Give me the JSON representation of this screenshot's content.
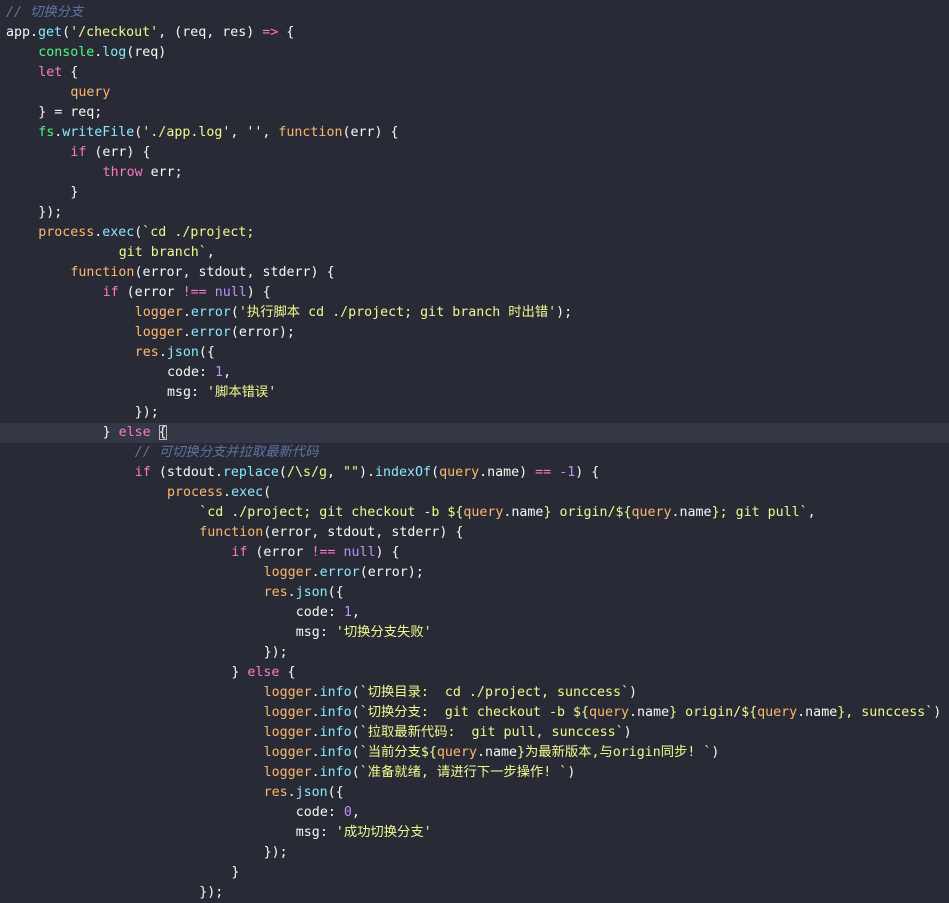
{
  "editor": {
    "background": "#282a36",
    "active_line_background": "#343746",
    "active_line": 21,
    "colors": {
      "comment": "#6272a4",
      "object": "#50fa7b",
      "function": "#8be9fd",
      "string": "#f1fa8c",
      "keyword": "#ff79c6",
      "number": "#bd93f9",
      "param": "#ffb86c",
      "plain": "#f8f8f2"
    },
    "lines": [
      {
        "indent": 0,
        "tokens": [
          {
            "t": "// 切换分支",
            "c": "comment"
          }
        ]
      },
      {
        "indent": 0,
        "tokens": [
          {
            "t": "app",
            "c": "plain"
          },
          {
            "t": ".",
            "c": "plain"
          },
          {
            "t": "get",
            "c": "fn"
          },
          {
            "t": "(",
            "c": "plain"
          },
          {
            "t": "'/checkout'",
            "c": "str"
          },
          {
            "t": ", (",
            "c": "plain"
          },
          {
            "t": "req",
            "c": "plain"
          },
          {
            "t": ", ",
            "c": "plain"
          },
          {
            "t": "res",
            "c": "plain"
          },
          {
            "t": ") ",
            "c": "plain"
          },
          {
            "t": "=>",
            "c": "op"
          },
          {
            "t": " {",
            "c": "plain"
          }
        ]
      },
      {
        "indent": 1,
        "tokens": [
          {
            "t": "console",
            "c": "obj"
          },
          {
            "t": ".",
            "c": "plain"
          },
          {
            "t": "log",
            "c": "fn"
          },
          {
            "t": "(req)",
            "c": "plain"
          }
        ]
      },
      {
        "indent": 1,
        "tokens": [
          {
            "t": "let",
            "c": "kw"
          },
          {
            "t": " {",
            "c": "plain"
          }
        ]
      },
      {
        "indent": 2,
        "tokens": [
          {
            "t": "query",
            "c": "param"
          }
        ]
      },
      {
        "indent": 1,
        "tokens": [
          {
            "t": "} = req;",
            "c": "plain"
          }
        ]
      },
      {
        "indent": 1,
        "tokens": [
          {
            "t": "fs",
            "c": "obj"
          },
          {
            "t": ".",
            "c": "plain"
          },
          {
            "t": "writeFile",
            "c": "fn"
          },
          {
            "t": "(",
            "c": "plain"
          },
          {
            "t": "'./app.log'",
            "c": "str"
          },
          {
            "t": ", ",
            "c": "plain"
          },
          {
            "t": "''",
            "c": "str"
          },
          {
            "t": ", ",
            "c": "plain"
          },
          {
            "t": "function",
            "c": "param"
          },
          {
            "t": "(err) {",
            "c": "plain"
          }
        ]
      },
      {
        "indent": 2,
        "tokens": [
          {
            "t": "if",
            "c": "kw"
          },
          {
            "t": " (err) {",
            "c": "plain"
          }
        ]
      },
      {
        "indent": 3,
        "tokens": [
          {
            "t": "throw",
            "c": "kw"
          },
          {
            "t": " err;",
            "c": "plain"
          }
        ]
      },
      {
        "indent": 2,
        "tokens": [
          {
            "t": "}",
            "c": "plain"
          }
        ]
      },
      {
        "indent": 1,
        "tokens": [
          {
            "t": "});",
            "c": "plain"
          }
        ]
      },
      {
        "indent": 1,
        "tokens": [
          {
            "t": "process",
            "c": "param"
          },
          {
            "t": ".",
            "c": "plain"
          },
          {
            "t": "exec",
            "c": "fn"
          },
          {
            "t": "(",
            "c": "plain"
          },
          {
            "t": "`cd ./project;",
            "c": "str"
          }
        ]
      },
      {
        "indent": 3.5,
        "tokens": [
          {
            "t": "git branch`",
            "c": "str"
          },
          {
            "t": ",",
            "c": "plain"
          }
        ]
      },
      {
        "indent": 2,
        "tokens": [
          {
            "t": "function",
            "c": "param"
          },
          {
            "t": "(error, stdout, stderr) {",
            "c": "plain"
          }
        ]
      },
      {
        "indent": 3,
        "tokens": [
          {
            "t": "if",
            "c": "kw"
          },
          {
            "t": " (error ",
            "c": "plain"
          },
          {
            "t": "!==",
            "c": "op"
          },
          {
            "t": " ",
            "c": "plain"
          },
          {
            "t": "null",
            "c": "num"
          },
          {
            "t": ") {",
            "c": "plain"
          }
        ]
      },
      {
        "indent": 4,
        "tokens": [
          {
            "t": "logger",
            "c": "param"
          },
          {
            "t": ".",
            "c": "plain"
          },
          {
            "t": "error",
            "c": "fn"
          },
          {
            "t": "(",
            "c": "plain"
          },
          {
            "t": "'执行脚本 cd ./project; git branch 时出错'",
            "c": "str"
          },
          {
            "t": ");",
            "c": "plain"
          }
        ]
      },
      {
        "indent": 4,
        "tokens": [
          {
            "t": "logger",
            "c": "param"
          },
          {
            "t": ".",
            "c": "plain"
          },
          {
            "t": "error",
            "c": "fn"
          },
          {
            "t": "(error);",
            "c": "plain"
          }
        ]
      },
      {
        "indent": 4,
        "tokens": [
          {
            "t": "res",
            "c": "param"
          },
          {
            "t": ".",
            "c": "plain"
          },
          {
            "t": "json",
            "c": "fn"
          },
          {
            "t": "({",
            "c": "plain"
          }
        ]
      },
      {
        "indent": 5,
        "tokens": [
          {
            "t": "code: ",
            "c": "plain"
          },
          {
            "t": "1",
            "c": "num"
          },
          {
            "t": ",",
            "c": "plain"
          }
        ]
      },
      {
        "indent": 5,
        "tokens": [
          {
            "t": "msg: ",
            "c": "plain"
          },
          {
            "t": "'脚本错误'",
            "c": "str"
          }
        ]
      },
      {
        "indent": 4,
        "tokens": [
          {
            "t": "});",
            "c": "plain"
          }
        ]
      },
      {
        "indent": 3,
        "tokens": [
          {
            "t": "} ",
            "c": "plain"
          },
          {
            "t": "else",
            "c": "kw"
          },
          {
            "t": " ",
            "c": "plain"
          },
          {
            "t": "{",
            "c": "bracket"
          }
        ]
      },
      {
        "indent": 4,
        "tokens": [
          {
            "t": "// 可切换分支并拉取最新代码",
            "c": "comment"
          }
        ]
      },
      {
        "indent": 4,
        "tokens": [
          {
            "t": "if",
            "c": "kw"
          },
          {
            "t": " (stdout.",
            "c": "plain"
          },
          {
            "t": "replace",
            "c": "fn"
          },
          {
            "t": "(",
            "c": "plain"
          },
          {
            "t": "/\\s/g",
            "c": "str"
          },
          {
            "t": ", ",
            "c": "plain"
          },
          {
            "t": "\"\"",
            "c": "str"
          },
          {
            "t": ").",
            "c": "plain"
          },
          {
            "t": "indexOf",
            "c": "fn"
          },
          {
            "t": "(",
            "c": "plain"
          },
          {
            "t": "query",
            "c": "param"
          },
          {
            "t": ".name) ",
            "c": "plain"
          },
          {
            "t": "==",
            "c": "op"
          },
          {
            "t": " ",
            "c": "plain"
          },
          {
            "t": "-1",
            "c": "num"
          },
          {
            "t": ") {",
            "c": "plain"
          }
        ]
      },
      {
        "indent": 5,
        "tokens": [
          {
            "t": "process",
            "c": "param"
          },
          {
            "t": ".",
            "c": "plain"
          },
          {
            "t": "exec",
            "c": "fn"
          },
          {
            "t": "(",
            "c": "plain"
          }
        ]
      },
      {
        "indent": 6,
        "tokens": [
          {
            "t": "`cd ./project; git checkout -b ${",
            "c": "str"
          },
          {
            "t": "query",
            "c": "param"
          },
          {
            "t": ".name",
            "c": "plain"
          },
          {
            "t": "} origin/${",
            "c": "str"
          },
          {
            "t": "query",
            "c": "param"
          },
          {
            "t": ".name",
            "c": "plain"
          },
          {
            "t": "}; git pull`",
            "c": "str"
          },
          {
            "t": ",",
            "c": "plain"
          }
        ]
      },
      {
        "indent": 6,
        "tokens": [
          {
            "t": "function",
            "c": "param"
          },
          {
            "t": "(error, stdout, stderr) {",
            "c": "plain"
          }
        ]
      },
      {
        "indent": 7,
        "tokens": [
          {
            "t": "if",
            "c": "kw"
          },
          {
            "t": " (error ",
            "c": "plain"
          },
          {
            "t": "!==",
            "c": "op"
          },
          {
            "t": " ",
            "c": "plain"
          },
          {
            "t": "null",
            "c": "num"
          },
          {
            "t": ") {",
            "c": "plain"
          }
        ]
      },
      {
        "indent": 8,
        "tokens": [
          {
            "t": "logger",
            "c": "param"
          },
          {
            "t": ".",
            "c": "plain"
          },
          {
            "t": "error",
            "c": "fn"
          },
          {
            "t": "(error);",
            "c": "plain"
          }
        ]
      },
      {
        "indent": 8,
        "tokens": [
          {
            "t": "res",
            "c": "param"
          },
          {
            "t": ".",
            "c": "plain"
          },
          {
            "t": "json",
            "c": "fn"
          },
          {
            "t": "({",
            "c": "plain"
          }
        ]
      },
      {
        "indent": 9,
        "tokens": [
          {
            "t": "code: ",
            "c": "plain"
          },
          {
            "t": "1",
            "c": "num"
          },
          {
            "t": ",",
            "c": "plain"
          }
        ]
      },
      {
        "indent": 9,
        "tokens": [
          {
            "t": "msg: ",
            "c": "plain"
          },
          {
            "t": "'切换分支失败'",
            "c": "str"
          }
        ]
      },
      {
        "indent": 8,
        "tokens": [
          {
            "t": "});",
            "c": "plain"
          }
        ]
      },
      {
        "indent": 7,
        "tokens": [
          {
            "t": "} ",
            "c": "plain"
          },
          {
            "t": "else",
            "c": "kw"
          },
          {
            "t": " {",
            "c": "plain"
          }
        ]
      },
      {
        "indent": 8,
        "tokens": [
          {
            "t": "logger",
            "c": "param"
          },
          {
            "t": ".",
            "c": "plain"
          },
          {
            "t": "info",
            "c": "fn"
          },
          {
            "t": "(",
            "c": "plain"
          },
          {
            "t": "`切换目录:  cd ./project, sunccess`",
            "c": "str"
          },
          {
            "t": ")",
            "c": "plain"
          }
        ]
      },
      {
        "indent": 8,
        "tokens": [
          {
            "t": "logger",
            "c": "param"
          },
          {
            "t": ".",
            "c": "plain"
          },
          {
            "t": "info",
            "c": "fn"
          },
          {
            "t": "(",
            "c": "plain"
          },
          {
            "t": "`切换分支:  git checkout -b ${",
            "c": "str"
          },
          {
            "t": "query",
            "c": "param"
          },
          {
            "t": ".name",
            "c": "plain"
          },
          {
            "t": "} origin/${",
            "c": "str"
          },
          {
            "t": "query",
            "c": "param"
          },
          {
            "t": ".name",
            "c": "plain"
          },
          {
            "t": "}, sunccess`",
            "c": "str"
          },
          {
            "t": ")",
            "c": "plain"
          }
        ]
      },
      {
        "indent": 8,
        "tokens": [
          {
            "t": "logger",
            "c": "param"
          },
          {
            "t": ".",
            "c": "plain"
          },
          {
            "t": "info",
            "c": "fn"
          },
          {
            "t": "(",
            "c": "plain"
          },
          {
            "t": "`拉取最新代码:  git pull, sunccess`",
            "c": "str"
          },
          {
            "t": ")",
            "c": "plain"
          }
        ]
      },
      {
        "indent": 8,
        "tokens": [
          {
            "t": "logger",
            "c": "param"
          },
          {
            "t": ".",
            "c": "plain"
          },
          {
            "t": "info",
            "c": "fn"
          },
          {
            "t": "(",
            "c": "plain"
          },
          {
            "t": "`当前分支${",
            "c": "str"
          },
          {
            "t": "query",
            "c": "param"
          },
          {
            "t": ".name",
            "c": "plain"
          },
          {
            "t": "}为最新版本,与origin同步! `",
            "c": "str"
          },
          {
            "t": ")",
            "c": "plain"
          }
        ]
      },
      {
        "indent": 8,
        "tokens": [
          {
            "t": "logger",
            "c": "param"
          },
          {
            "t": ".",
            "c": "plain"
          },
          {
            "t": "info",
            "c": "fn"
          },
          {
            "t": "(",
            "c": "plain"
          },
          {
            "t": "`准备就绪, 请进行下一步操作! `",
            "c": "str"
          },
          {
            "t": ")",
            "c": "plain"
          }
        ]
      },
      {
        "indent": 8,
        "tokens": [
          {
            "t": "res",
            "c": "param"
          },
          {
            "t": ".",
            "c": "plain"
          },
          {
            "t": "json",
            "c": "fn"
          },
          {
            "t": "({",
            "c": "plain"
          }
        ]
      },
      {
        "indent": 9,
        "tokens": [
          {
            "t": "code: ",
            "c": "plain"
          },
          {
            "t": "0",
            "c": "num"
          },
          {
            "t": ",",
            "c": "plain"
          }
        ]
      },
      {
        "indent": 9,
        "tokens": [
          {
            "t": "msg: ",
            "c": "plain"
          },
          {
            "t": "'成功切换分支'",
            "c": "str"
          }
        ]
      },
      {
        "indent": 8,
        "tokens": [
          {
            "t": "});",
            "c": "plain"
          }
        ]
      },
      {
        "indent": 7,
        "tokens": [
          {
            "t": "}",
            "c": "plain"
          }
        ]
      },
      {
        "indent": 6,
        "tokens": [
          {
            "t": "});",
            "c": "plain"
          }
        ]
      }
    ]
  }
}
